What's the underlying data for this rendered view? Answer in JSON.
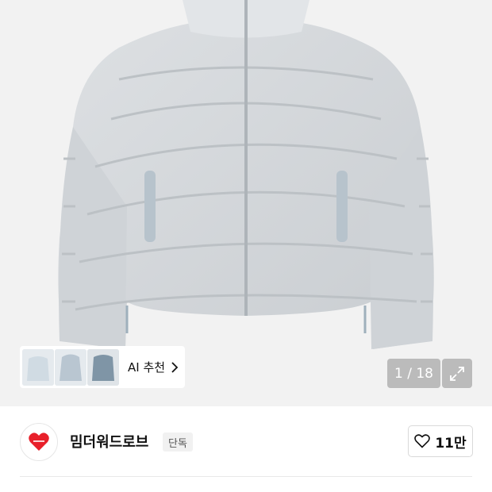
{
  "gallery": {
    "counter_text": "1 / 18"
  },
  "ai_recommend": {
    "label": "AI 추천"
  },
  "brand": {
    "name": "밈더워드로브",
    "badge": "단독"
  },
  "like": {
    "count": "11만"
  },
  "colors": {
    "jacket": "#d5d9dc",
    "background": "#f2f2f2",
    "heart_red": "#e8202a"
  },
  "icons": [
    "chevron-right-icon",
    "expand-icon",
    "heart-outline-icon",
    "heart-logo-icon"
  ]
}
